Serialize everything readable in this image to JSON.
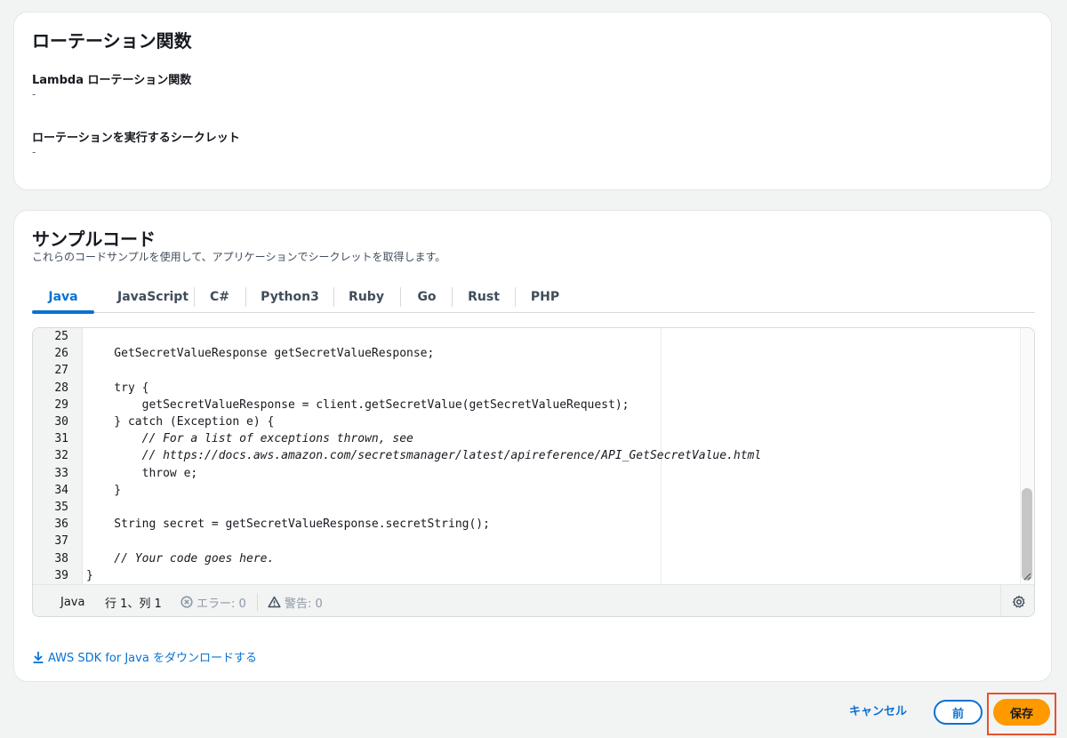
{
  "rotation_section": {
    "title": "ローテーション関数",
    "lambda_label": "Lambda ローテーション関数",
    "lambda_value": "-",
    "secret_label": "ローテーションを実行するシークレット",
    "secret_value": "-"
  },
  "sample_section": {
    "title": "サンプルコード",
    "description": "これらのコードサンプルを使用して、アプリケーションでシークレットを取得します。",
    "tabs": [
      "Java",
      "JavaScript",
      "C#",
      "Python3",
      "Ruby",
      "Go",
      "Rust",
      "PHP"
    ],
    "active_tab": "Java",
    "code_lines": [
      {
        "no": "25",
        "text": ""
      },
      {
        "no": "26",
        "text": "    GetSecretValueResponse getSecretValueResponse;"
      },
      {
        "no": "27",
        "text": ""
      },
      {
        "no": "28",
        "text": "    try {"
      },
      {
        "no": "29",
        "text": "        getSecretValueResponse = client.getSecretValue(getSecretValueRequest);"
      },
      {
        "no": "30",
        "text": "    } catch (Exception e) {"
      },
      {
        "no": "31",
        "text": "        // For a list of exceptions thrown, see"
      },
      {
        "no": "32",
        "text": "        // https://docs.aws.amazon.com/secretsmanager/latest/apireference/API_GetSecretValue.html"
      },
      {
        "no": "33",
        "text": "        throw e;"
      },
      {
        "no": "34",
        "text": "    }"
      },
      {
        "no": "35",
        "text": ""
      },
      {
        "no": "36",
        "text": "    String secret = getSecretValueResponse.secretString();"
      },
      {
        "no": "37",
        "text": ""
      },
      {
        "no": "38",
        "text": "    // Your code goes here."
      },
      {
        "no": "39",
        "text": "}"
      }
    ],
    "status_bar": {
      "language": "Java",
      "position": "行 1、列 1",
      "errors": "エラー: 0",
      "warnings": "警告: 0"
    },
    "download_link": "AWS SDK for Java をダウンロードする"
  },
  "footer": {
    "cancel_label": "キャンセル",
    "prev_label": "前",
    "save_label": "保存"
  },
  "colors": {
    "link": "#0972d3",
    "primary_button": "#ff9900",
    "highlight_border": "#e5532e"
  }
}
